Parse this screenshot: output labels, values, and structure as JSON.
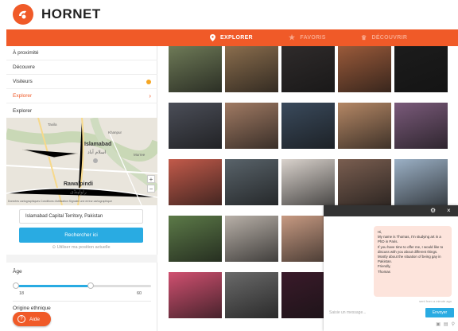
{
  "app": {
    "logo_text": "HORNET",
    "brand_color": "#f05a28",
    "accent_blue": "#29abe2"
  },
  "nav": {
    "items": [
      {
        "label": "EXPLORER",
        "icon": "location-pin-icon",
        "active": true
      },
      {
        "label": "FAVORIS",
        "icon": "star-icon",
        "active": false
      },
      {
        "label": "DÉCOUVRIR",
        "icon": "crown-icon",
        "active": false
      }
    ]
  },
  "sidebar": {
    "items": [
      {
        "label": "À proximité"
      },
      {
        "label": "Découvre"
      },
      {
        "label": "Visiteurs",
        "badge": "dot"
      },
      {
        "label": "Explorer",
        "active": true
      },
      {
        "label": "Explorer"
      }
    ],
    "map": {
      "city_main": "Islamabad",
      "city_main_native": "اسلام آباد",
      "city_second": "Rawalpindi",
      "city_second_native": "راولپنڈی",
      "small_labels": [
        "Taxila",
        "Khanpur",
        "Murree"
      ],
      "footer": "Données cartographiques   Conditions d'utilisation   Signaler une erreur cartographique"
    },
    "location_value": "Islamabad Capital Territory, Pakistan",
    "search_button": "Rechercher ici",
    "use_location": "Utiliser ma position actuelle",
    "age": {
      "label": "Âge",
      "min": "18",
      "max": "60",
      "low_fraction": 0.0,
      "high_fraction": 0.55
    },
    "ethnic_label": "Origine ethnique",
    "help_button": "Aide"
  },
  "grid": {
    "tiles": [
      {
        "color": "#6e7a57",
        "overlay_text": ""
      },
      {
        "color": "#8a6d4d",
        "overlay_text": ""
      },
      {
        "color": "#2f2b2b",
        "overlay_text": ""
      },
      {
        "color": "#9a5a3a",
        "overlay_text": ""
      },
      {
        "color": "#1c1c1c",
        "overlay_text": ""
      },
      {
        "color": "#4b4e58",
        "overlay_text": ""
      },
      {
        "color": "#a07a63",
        "overlay_text": ""
      },
      {
        "color": "#3a4a5c",
        "overlay_text": ""
      },
      {
        "color": "#b48765",
        "overlay_text": ""
      },
      {
        "color": "#7a5a7a",
        "overlay_text": ""
      },
      {
        "color": "#c25a4a",
        "overlay_text": ""
      },
      {
        "color": "#59636a",
        "overlay_text": ""
      },
      {
        "color": "#d9d2cc",
        "overlay_text": ""
      },
      {
        "color": "#7a5e50",
        "overlay_text": ""
      },
      {
        "color": "#9bb0c5",
        "overlay_text": ""
      },
      {
        "color": "#5c7a48",
        "overlay_text": ""
      },
      {
        "color": "#b8b0a8",
        "overlay_text": ""
      },
      {
        "color": "#c79a82",
        "overlay_text": ""
      },
      {
        "color": "#4a4a4a",
        "overlay_text": ""
      },
      {
        "color": "#e0a060",
        "overlay_text": ""
      },
      {
        "color": "#d05070",
        "overlay_text": ""
      },
      {
        "color": "#6a6a6a",
        "overlay_text": ""
      },
      {
        "color": "#3a1a2a",
        "overlay_text": ""
      },
      {
        "color": "#c84a3a",
        "overlay_text": ""
      },
      {
        "color": "#8a6a5a",
        "overlay_text": ""
      }
    ]
  },
  "chat": {
    "message": "Hi,\nMy name is Thomas, I'm studying art in a PhD in Paris.\nIf you have time to offer me, I would like to discuss with you about different things. Mostly about the situation of being gay in Pakistan.\nFriendly,\nThomas",
    "timestamp": "sent from a minute ago",
    "input_placeholder": "Saisie un message...",
    "send_button": "Envoyer"
  }
}
